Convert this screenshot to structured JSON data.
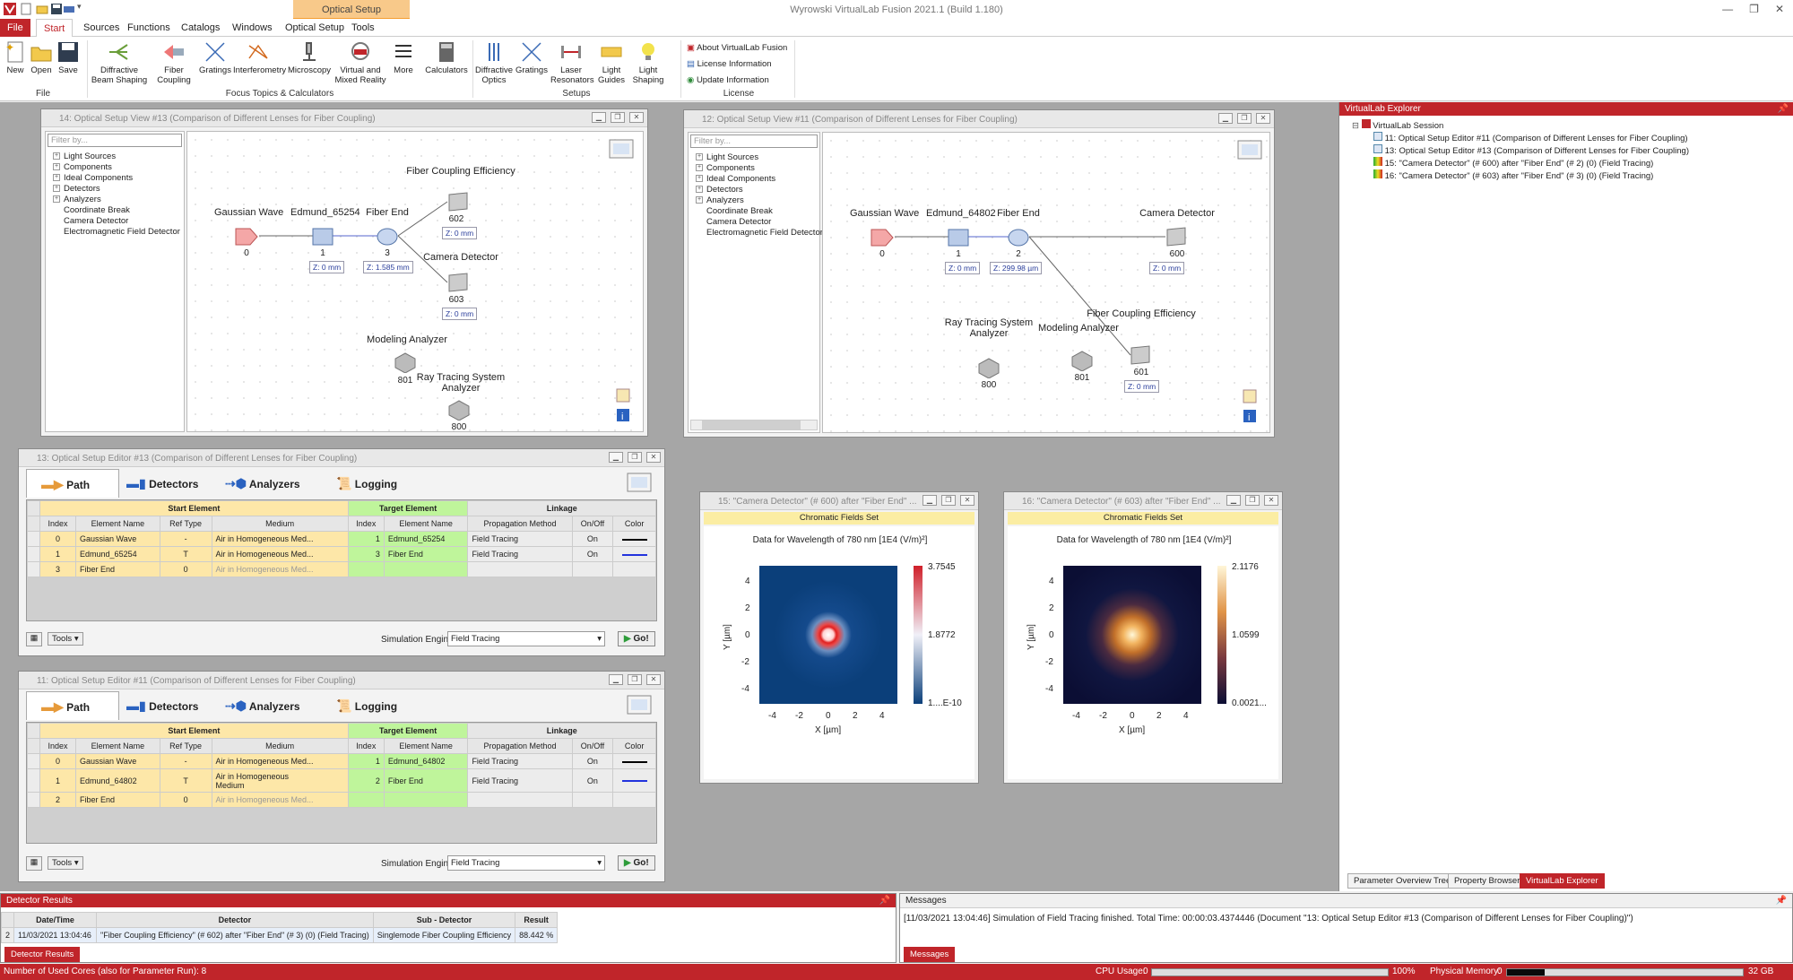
{
  "app": {
    "title": "Wyrowski VirtualLab Fusion 2021.1 (Build 1.180)",
    "context_tab": "Optical Setup"
  },
  "menu": {
    "tabs": [
      "File",
      "Start",
      "Sources",
      "Functions",
      "Catalogs",
      "Windows",
      "Optical Setup",
      "Tools"
    ]
  },
  "ribbon": {
    "file_buttons": [
      "New",
      "Open",
      "Save"
    ],
    "file_group": "File",
    "focus_buttons": [
      "Diffractive\nBeam Shaping",
      "Fiber\nCoupling",
      "Gratings",
      "Interferometry",
      "Microscopy",
      "Virtual and\nMixed Reality",
      "More",
      "Calculators"
    ],
    "focus_group": "Focus Topics & Calculators",
    "setup_buttons": [
      "Diffractive\nOptics",
      "Gratings",
      "Laser\nResonators",
      "Light\nGuides",
      "Light\nShaping"
    ],
    "setup_group": "Setups",
    "license_items": [
      "About VirtualLab Fusion",
      "License Information",
      "Update Information"
    ],
    "license_group": "License"
  },
  "view14": {
    "title": "14: Optical Setup View #13 (Comparison of Different Lenses for Fiber Coupling)",
    "filter": "Filter by...",
    "tree": [
      "Light Sources",
      "Components",
      "Ideal Components",
      "Detectors",
      "Analyzers",
      "Coordinate Break",
      "Camera Detector",
      "Electromagnetic Field Detector"
    ],
    "nodes": {
      "gw": "Gaussian Wave",
      "ed": "Edmund_65254",
      "fe": "Fiber End",
      "fce": "Fiber Coupling Efficiency",
      "cd": "Camera Detector",
      "ma": "Modeling Analyzer",
      "rt": "Ray Tracing System\nAnalyzer"
    },
    "idx": {
      "gw": "0",
      "ed": "1",
      "fe": "3",
      "fce": "602",
      "cd": "603",
      "ma": "801",
      "rt": "800"
    },
    "z": {
      "ed": "Z: 0 mm",
      "fe": "Z: 1.585 mm",
      "fce": "Z: 0 mm",
      "cd": "Z: 0 mm"
    }
  },
  "view12": {
    "title": "12: Optical Setup View #11 (Comparison of Different Lenses for Fiber Coupling)",
    "filter": "Filter by...",
    "tree": [
      "Light Sources",
      "Components",
      "Ideal Components",
      "Detectors",
      "Analyzers",
      "Coordinate Break",
      "Camera Detector",
      "Electromagnetic Field Detector"
    ],
    "nodes": {
      "gw": "Gaussian Wave",
      "ed": "Edmund_64802",
      "fe": "Fiber End",
      "cd": "Camera Detector",
      "fce": "Fiber Coupling Efficiency",
      "ma": "Modeling Analyzer",
      "rt": "Ray Tracing System\nAnalyzer"
    },
    "idx": {
      "gw": "0",
      "ed": "1",
      "fe": "2",
      "cd": "600",
      "fce": "601",
      "ma": "801",
      "rt": "800"
    },
    "z": {
      "ed": "Z: 0 mm",
      "fe": "Z: 299.98 µm",
      "cd": "Z: 0 mm",
      "fce": "Z: 0 mm"
    }
  },
  "editor13": {
    "title": "13: Optical Setup Editor #13 (Comparison of Different Lenses for Fiber Coupling)",
    "tabs": [
      "Path",
      "Detectors",
      "Analyzers",
      "Logging"
    ],
    "group_headers": [
      "Start Element",
      "Target Element",
      "Linkage"
    ],
    "col_headers": [
      "Index",
      "Element Name",
      "Ref Type",
      "Medium",
      "Index",
      "Element Name",
      "Propagation Method",
      "On/Off",
      "Color"
    ],
    "rows": [
      [
        "0",
        "Gaussian Wave",
        "-",
        "Air in Homogeneous Med...",
        "1",
        "Edmund_65254",
        "Field Tracing",
        "On",
        "black"
      ],
      [
        "1",
        "Edmund_65254",
        "T",
        "Air in Homogeneous Med...",
        "3",
        "Fiber End",
        "Field Tracing",
        "On",
        "blue"
      ],
      [
        "3",
        "Fiber End",
        "0",
        "Air in Homogeneous Med...",
        "",
        "",
        "",
        "",
        ""
      ]
    ],
    "tools": "Tools",
    "sim_label": "Simulation Engine",
    "sim_value": "Field Tracing",
    "go": "Go!"
  },
  "editor11": {
    "title": "11: Optical Setup Editor #11 (Comparison of Different Lenses for Fiber Coupling)",
    "tabs": [
      "Path",
      "Detectors",
      "Analyzers",
      "Logging"
    ],
    "group_headers": [
      "Start Element",
      "Target Element",
      "Linkage"
    ],
    "col_headers": [
      "Index",
      "Element Name",
      "Ref Type",
      "Medium",
      "Index",
      "Element Name",
      "Propagation Method",
      "On/Off",
      "Color"
    ],
    "rows": [
      [
        "0",
        "Gaussian Wave",
        "-",
        "Air in Homogeneous Med...",
        "1",
        "Edmund_64802",
        "Field Tracing",
        "On",
        "black"
      ],
      [
        "1",
        "Edmund_64802",
        "T",
        "Air in Homogeneous\nMedium",
        "2",
        "Fiber End",
        "Field Tracing",
        "On",
        "blue"
      ],
      [
        "2",
        "Fiber End",
        "0",
        "Air in Homogeneous Med...",
        "",
        "",
        "",
        "",
        ""
      ]
    ],
    "tools": "Tools",
    "sim_label": "Simulation Engine",
    "sim_value": "Field Tracing",
    "go": "Go!"
  },
  "plot15": {
    "title": "15: \"Camera Detector\" (# 600) after \"Fiber End\" ...",
    "set": "Chromatic Fields Set",
    "header": "Data for Wavelength of 780 nm  [1E4 (V/m)²]",
    "cb": [
      "3.7545",
      "1.8772",
      "1....E-10"
    ],
    "xticks": [
      "-4",
      "-2",
      "0",
      "2",
      "4"
    ],
    "yticks": [
      "4",
      "2",
      "0",
      "-2",
      "-4"
    ],
    "xlabel": "X [µm]",
    "ylabel": "Y [µm]"
  },
  "plot16": {
    "title": "16: \"Camera Detector\" (# 603) after \"Fiber End\" ...",
    "set": "Chromatic Fields Set",
    "header": "Data for Wavelength of 780 nm  [1E4 (V/m)²]",
    "cb": [
      "2.1176",
      "1.0599",
      "0.0021..."
    ],
    "xticks": [
      "-4",
      "-2",
      "0",
      "2",
      "4"
    ],
    "yticks": [
      "4",
      "2",
      "0",
      "-2",
      "-4"
    ],
    "xlabel": "X [µm]",
    "ylabel": "Y [µm]"
  },
  "explorer": {
    "title": "VirtualLab Explorer",
    "root": "VirtualLab Session",
    "items": [
      "11: Optical Setup Editor #11 (Comparison of Different Lenses for Fiber Coupling)",
      "13: Optical Setup Editor #13 (Comparison of Different Lenses for Fiber Coupling)",
      "15: \"Camera Detector\" (# 600) after \"Fiber End\" (# 2) (0) (Field Tracing)",
      "16: \"Camera Detector\" (# 603) after \"Fiber End\" (# 3) (0) (Field Tracing)"
    ],
    "bottom_tabs": [
      "Parameter Overview Tree",
      "Property Browser",
      "VirtualLab Explorer"
    ]
  },
  "detector_results": {
    "title": "Detector Results",
    "headers": [
      "Date/Time",
      "Detector",
      "Sub - Detector",
      "Result"
    ],
    "row": [
      "2",
      "11/03/2021 13:04:46",
      "\"Fiber Coupling Efficiency\" (# 602) after \"Fiber End\" (# 3) (0) (Field Tracing)",
      "Singlemode Fiber Coupling Efficiency",
      "88.442 %"
    ],
    "tab": "Detector Results"
  },
  "messages": {
    "title": "Messages",
    "text": "[11/03/2021 13:04:46] Simulation of Field Tracing finished. Total Time: 00:00:03.4374446 (Document \"13: Optical Setup Editor #13 (Comparison of Different Lenses for Fiber Coupling)\")",
    "tab": "Messages"
  },
  "status": {
    "left": "Number of Used Cores (also for Parameter Run): 8",
    "cpu_label": "CPU Usage:",
    "cpu_min": "0",
    "cpu_max": "100%",
    "mem_label": "Physical Memory:",
    "mem_min": "0",
    "mem_max": "32 GB"
  }
}
